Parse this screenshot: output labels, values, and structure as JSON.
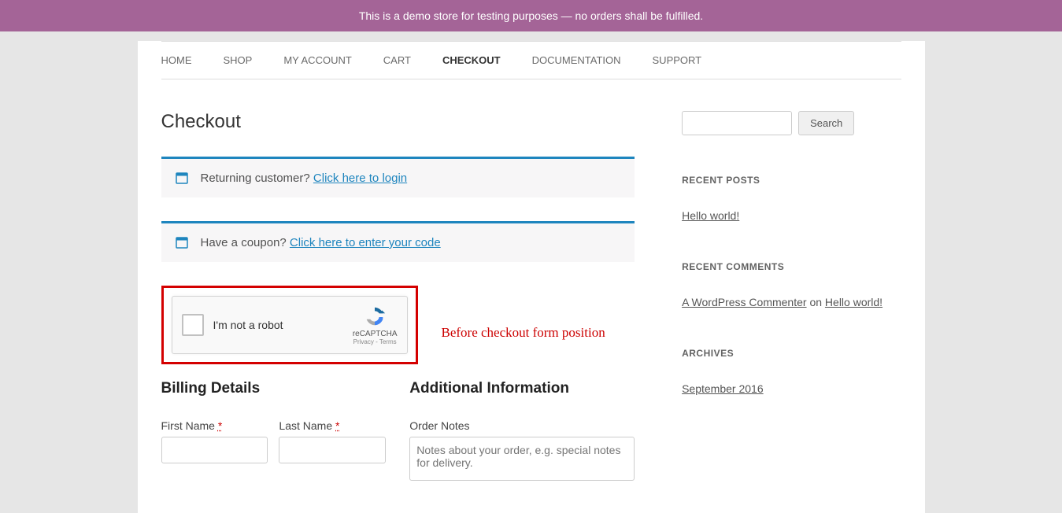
{
  "demo_banner": "This is a demo store for testing purposes — no orders shall be fulfilled.",
  "nav": {
    "home": "HOME",
    "shop": "SHOP",
    "my_account": "MY ACCOUNT",
    "cart": "CART",
    "checkout": "CHECKOUT",
    "documentation": "DOCUMENTATION",
    "support": "SUPPORT"
  },
  "page_title": "Checkout",
  "login_notice": {
    "text": "Returning customer? ",
    "link": "Click here to login"
  },
  "coupon_notice": {
    "text": "Have a coupon? ",
    "link": "Click here to enter your code"
  },
  "recaptcha": {
    "label": "I'm not a robot",
    "brand": "reCAPTCHA",
    "privacy": "Privacy",
    "terms": "Terms",
    "sep": " - "
  },
  "annotation": "Before checkout form position",
  "billing": {
    "heading": "Billing Details",
    "first_name": "First Name",
    "last_name": "Last Name",
    "required": "*"
  },
  "additional": {
    "heading": "Additional Information",
    "order_notes_label": "Order Notes",
    "order_notes_placeholder": "Notes about your order, e.g. special notes for delivery."
  },
  "sidebar": {
    "search_button": "Search",
    "recent_posts": {
      "title": "RECENT POSTS",
      "item1": "Hello world!"
    },
    "recent_comments": {
      "title": "RECENT COMMENTS",
      "commenter": "A WordPress Commenter",
      "on_text": " on ",
      "post": "Hello world!"
    },
    "archives": {
      "title": "ARCHIVES",
      "item1": "September 2016"
    }
  }
}
